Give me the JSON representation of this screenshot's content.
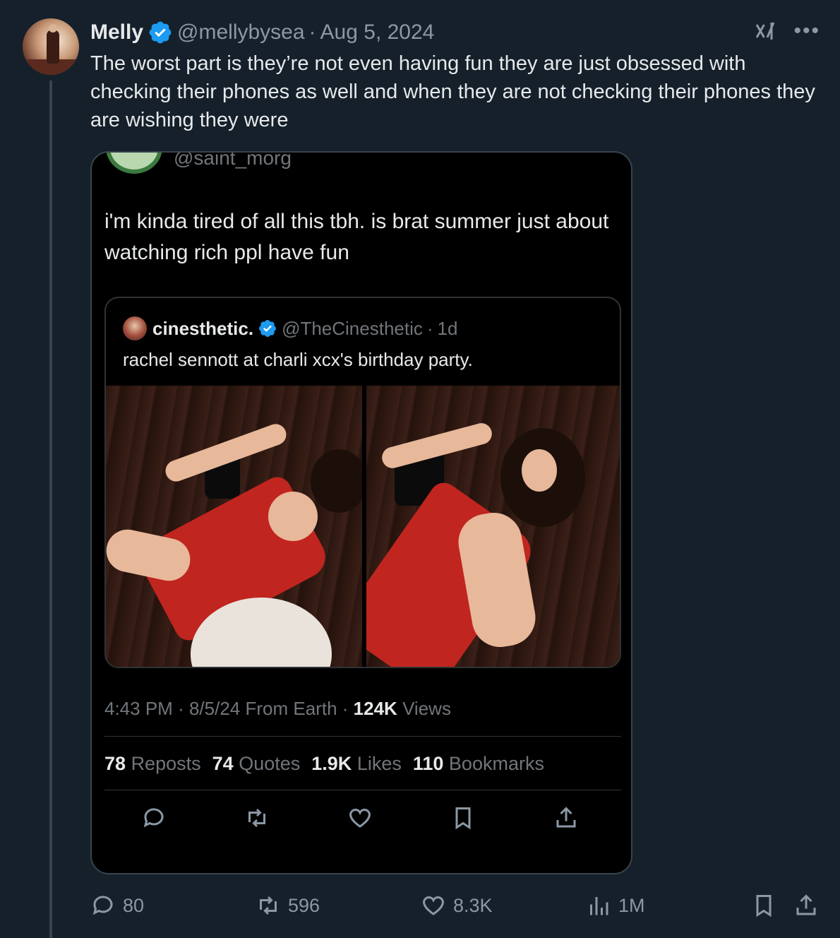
{
  "tweet": {
    "name": "Melly",
    "handle": "@mellybysea",
    "separator": "·",
    "date": "Aug 5, 2024",
    "text": "The worst part is they’re not even having fun they are just obsessed with checking their phones as well and when they are not checking their phones they are wishing they were"
  },
  "screenshot": {
    "handle": "@saint_morg",
    "text": "i'm kinda tired of all this tbh. is brat summer just about watching rich ppl have fun",
    "quote": {
      "name": "cinesthetic.",
      "handle": "@TheCinesthetic",
      "separator": "·",
      "time": "1d",
      "text": "rachel sennott at charli xcx's birthday party."
    },
    "meta": {
      "time": "4:43 PM",
      "date": "8/5/24",
      "source": "From Earth",
      "views_count": "124K",
      "views_label": "Views",
      "dot": "·"
    },
    "stats": [
      {
        "count": "78",
        "label": "Reposts"
      },
      {
        "count": "74",
        "label": "Quotes"
      },
      {
        "count": "1.9K",
        "label": "Likes"
      },
      {
        "count": "110",
        "label": "Bookmarks"
      }
    ]
  },
  "actions": {
    "replies": "80",
    "reposts": "596",
    "likes": "8.3K",
    "views": "1M"
  },
  "colors": {
    "background": "#15202b",
    "verified": "#1d9bf0",
    "muted": "#8b98a5"
  }
}
